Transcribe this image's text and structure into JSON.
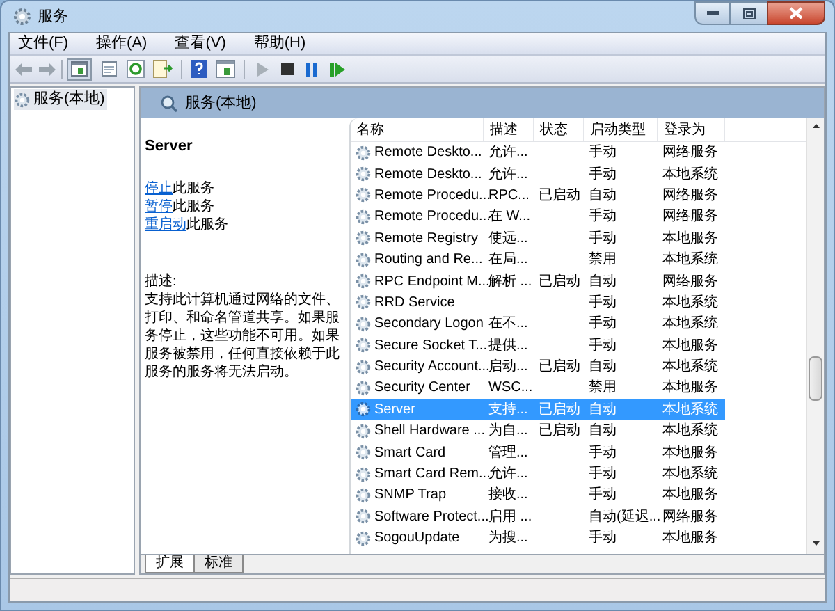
{
  "window": {
    "title": "服务"
  },
  "menu": [
    "文件(F)",
    "操作(A)",
    "查看(V)",
    "帮助(H)"
  ],
  "tree": {
    "items": [
      {
        "label": "服务(本地)",
        "selected": true
      }
    ]
  },
  "panel_title": "服务(本地)",
  "details": {
    "service_name": "Server",
    "actions": [
      {
        "link": "停止",
        "text": "此服务"
      },
      {
        "link": "暂停",
        "text": "此服务"
      },
      {
        "link": "重启动",
        "text": "此服务"
      }
    ],
    "description_label": "描述:",
    "description": "支持此计算机通过网络的文件、打印、和命名管道共享。如果服务停止，这些功能不可用。如果服务被禁用，任何直接依赖于此服务的服务将无法启动。"
  },
  "table": {
    "columns": [
      "名称",
      "描述",
      "状态",
      "启动类型",
      "登录为"
    ],
    "rows": [
      {
        "name": "Remote Deskto...",
        "description": "允许...",
        "status": "",
        "startup": "手动",
        "logon": "网络服务",
        "selected": false
      },
      {
        "name": "Remote Deskto...",
        "description": "允许...",
        "status": "",
        "startup": "手动",
        "logon": "本地系统",
        "selected": false
      },
      {
        "name": "Remote Procedu...",
        "description": "RPC...",
        "status": "已启动",
        "startup": "自动",
        "logon": "网络服务",
        "selected": false
      },
      {
        "name": "Remote Procedu...",
        "description": "在 W...",
        "status": "",
        "startup": "手动",
        "logon": "网络服务",
        "selected": false
      },
      {
        "name": "Remote Registry",
        "description": "使远...",
        "status": "",
        "startup": "手动",
        "logon": "本地服务",
        "selected": false
      },
      {
        "name": "Routing and Re...",
        "description": "在局...",
        "status": "",
        "startup": "禁用",
        "logon": "本地系统",
        "selected": false
      },
      {
        "name": "RPC Endpoint M...",
        "description": "解析 ...",
        "status": "已启动",
        "startup": "自动",
        "logon": "网络服务",
        "selected": false
      },
      {
        "name": "RRD Service",
        "description": "",
        "status": "",
        "startup": "手动",
        "logon": "本地系统",
        "selected": false
      },
      {
        "name": "Secondary Logon",
        "description": "在不...",
        "status": "",
        "startup": "手动",
        "logon": "本地系统",
        "selected": false
      },
      {
        "name": "Secure Socket T...",
        "description": "提供...",
        "status": "",
        "startup": "手动",
        "logon": "本地服务",
        "selected": false
      },
      {
        "name": "Security Account...",
        "description": "启动...",
        "status": "已启动",
        "startup": "自动",
        "logon": "本地系统",
        "selected": false
      },
      {
        "name": "Security Center",
        "description": "WSC...",
        "status": "",
        "startup": "禁用",
        "logon": "本地服务",
        "selected": false
      },
      {
        "name": "Server",
        "description": "支持...",
        "status": "已启动",
        "startup": "自动",
        "logon": "本地系统",
        "selected": true
      },
      {
        "name": "Shell Hardware ...",
        "description": "为自...",
        "status": "已启动",
        "startup": "自动",
        "logon": "本地系统",
        "selected": false
      },
      {
        "name": "Smart Card",
        "description": "管理...",
        "status": "",
        "startup": "手动",
        "logon": "本地服务",
        "selected": false
      },
      {
        "name": "Smart Card Rem...",
        "description": "允许...",
        "status": "",
        "startup": "手动",
        "logon": "本地系统",
        "selected": false
      },
      {
        "name": "SNMP Trap",
        "description": "接收...",
        "status": "",
        "startup": "手动",
        "logon": "本地服务",
        "selected": false
      },
      {
        "name": "Software Protect...",
        "description": "启用 ...",
        "status": "",
        "startup": "自动(延迟...",
        "logon": "网络服务",
        "selected": false
      },
      {
        "name": "SogouUpdate",
        "description": "为搜...",
        "status": "",
        "startup": "手动",
        "logon": "本地服务",
        "selected": false
      }
    ]
  },
  "tabs": [
    {
      "label": "扩展",
      "selected": true
    },
    {
      "label": "标准",
      "selected": false
    }
  ]
}
